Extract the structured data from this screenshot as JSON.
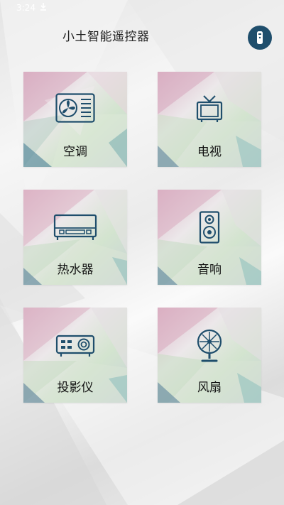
{
  "status_bar": {
    "time": "3:24",
    "download_icon": "download-arrow-icon"
  },
  "header": {
    "title": "小土智能遥控器",
    "remote_button_icon": "remote-control-icon",
    "remote_button_color": "#1f4e6c"
  },
  "devices": [
    {
      "label": "空调",
      "icon": "air-conditioner-icon"
    },
    {
      "label": "电视",
      "icon": "tv-icon"
    },
    {
      "label": "热水器",
      "icon": "water-heater-icon"
    },
    {
      "label": "音响",
      "icon": "speaker-icon"
    },
    {
      "label": "投影仪",
      "icon": "projector-icon"
    },
    {
      "label": "风扇",
      "icon": "fan-icon"
    }
  ],
  "colors": {
    "icon_stroke": "#1f4e6c",
    "tile_pink": "#d9b8c9",
    "tile_green": "#c3dcc0",
    "tile_teal": "#5d9aa4"
  }
}
